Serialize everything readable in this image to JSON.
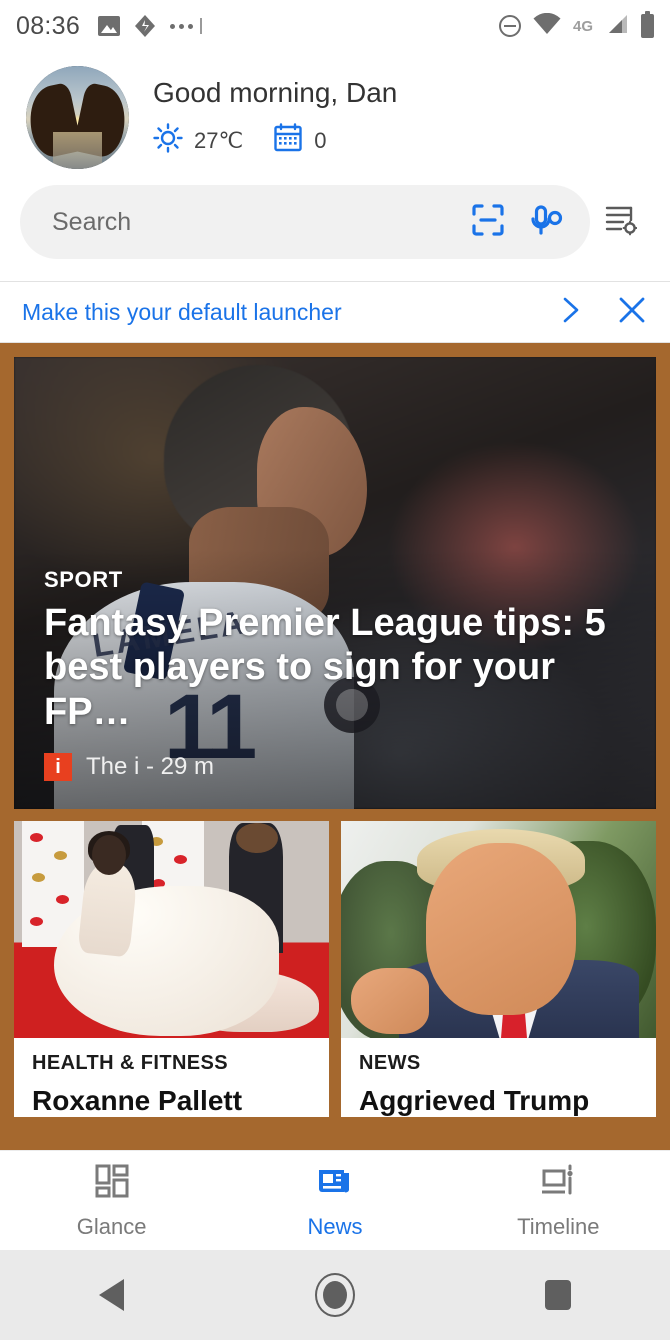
{
  "status_bar": {
    "time": "08:36",
    "left_icons": [
      "image-icon",
      "drive-icon",
      "more-notifications-icon"
    ],
    "network_label": "4G",
    "right_icons": [
      "do-not-disturb-icon",
      "wifi-icon",
      "signal-icon",
      "battery-icon"
    ]
  },
  "greeting": {
    "avatar_alt": "heart-hands-sunset-avatar",
    "title": "Good morning, Dan",
    "weather": {
      "icon": "sun-icon",
      "value": "27℃"
    },
    "calendar": {
      "icon": "calendar-icon",
      "value": "0"
    }
  },
  "search": {
    "placeholder": "Search",
    "lens_icon": "lens-scan-icon",
    "mic_icon": "microphone-icon",
    "feed_settings_icon": "feed-settings-icon"
  },
  "banner": {
    "text": "Make this your default launcher",
    "next_icon": "chevron-right-icon",
    "close_icon": "close-icon"
  },
  "feed": {
    "hero": {
      "kicker": "SPORT",
      "headline": "Fantasy Premier League tips: 5 best players to sign for your FP…",
      "source_badge": "i",
      "source": "The i - 29 m",
      "image_alt": "footballer-lamela-back-view"
    },
    "cards": [
      {
        "kicker": "HEALTH & FITNESS",
        "title": "Roxanne Pallett",
        "image_alt": "woman-in-gown-on-red-carpet"
      },
      {
        "kicker": "NEWS",
        "title": "Aggrieved Trump",
        "image_alt": "man-in-suit-pointing"
      }
    ]
  },
  "bottom_nav": {
    "items": [
      {
        "label": "Glance",
        "icon": "glance-grid-icon",
        "active": false
      },
      {
        "label": "News",
        "icon": "news-paper-icon",
        "active": true
      },
      {
        "label": "Timeline",
        "icon": "timeline-icon",
        "active": false
      }
    ]
  },
  "system_nav": {
    "back_icon": "back-triangle-icon",
    "home_icon": "home-circle-icon",
    "recents_icon": "recents-square-icon"
  },
  "colors": {
    "accent": "#1a73e8",
    "background": "#a5682e",
    "source_badge": "#e8401f",
    "inactive_text": "#7a7a7a"
  }
}
